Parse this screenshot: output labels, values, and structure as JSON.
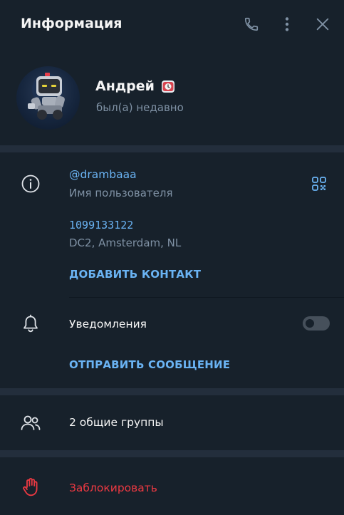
{
  "header": {
    "title": "Информация"
  },
  "profile": {
    "name": "Андрей",
    "status": "был(а) недавно"
  },
  "info": {
    "username": "@drambaaa",
    "username_caption": "Имя пользователя",
    "user_id": "1099133122",
    "dc_location": "DC2, Amsterdam, NL",
    "add_contact": "ДОБАВИТЬ КОНТАКТ"
  },
  "notifications": {
    "label": "Уведомления",
    "enabled": false,
    "send_message": "ОТПРАВИТЬ СООБЩЕНИЕ"
  },
  "groups": {
    "label": "2 общие группы"
  },
  "block": {
    "label": "Заблокировать"
  },
  "colors": {
    "background": "#17212b",
    "separator": "#232e3c",
    "accent": "#6ab3f3",
    "secondary_text": "#7f91a4",
    "danger": "#ec3942"
  }
}
